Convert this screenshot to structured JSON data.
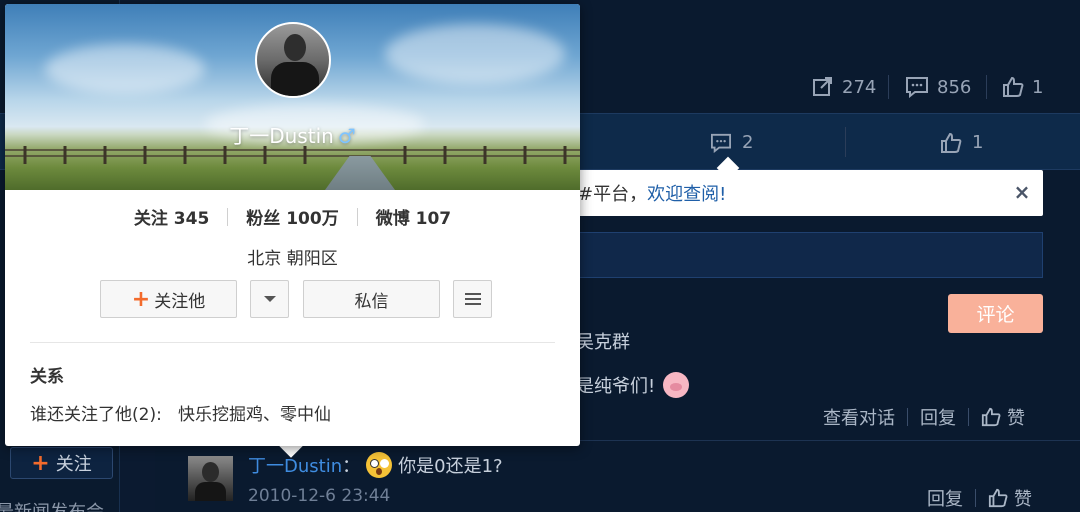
{
  "stats": {
    "repost": "274",
    "comment": "856",
    "like": "1"
  },
  "action_bar": {
    "comment_count": "2",
    "like_count": "1"
  },
  "notice": {
    "text_prefix": "#平台，",
    "link_text": "欢迎查阅!",
    "close": "×"
  },
  "comment_button": "评论",
  "comments": [
    {
      "name_fragment": "吴克群",
      "text_fragment": "是纯爷们!",
      "actions": {
        "view": "查看对话",
        "reply": "回复",
        "like": "赞"
      }
    },
    {
      "name": "丁一Dustin",
      "separator": "：",
      "text": "你是0还是1?",
      "time": "2010-12-6 23:44",
      "actions": {
        "reply": "回复",
        "like": "赞"
      }
    }
  ],
  "side": {
    "follow_label": "关注",
    "bottom_text": "最新闻发布会"
  },
  "profile_card": {
    "name": "丁一Dustin",
    "gender_icon": "♂",
    "following_label": "关注",
    "following": "345",
    "fans_label": "粉丝",
    "fans": "100万",
    "weibo_label": "微博",
    "weibo": "107",
    "location": "北京 朝阳区",
    "follow_button": "关注他",
    "message_button": "私信",
    "relation_title": "关系",
    "relation_label": "谁还关注了他(2):",
    "relation_users": "快乐挖掘鸡、零中仙"
  },
  "colors": {
    "background": "#0b1a30",
    "accent": "#f36b2c",
    "comment_button": "#f9b19a",
    "link": "#3f8ce0"
  }
}
